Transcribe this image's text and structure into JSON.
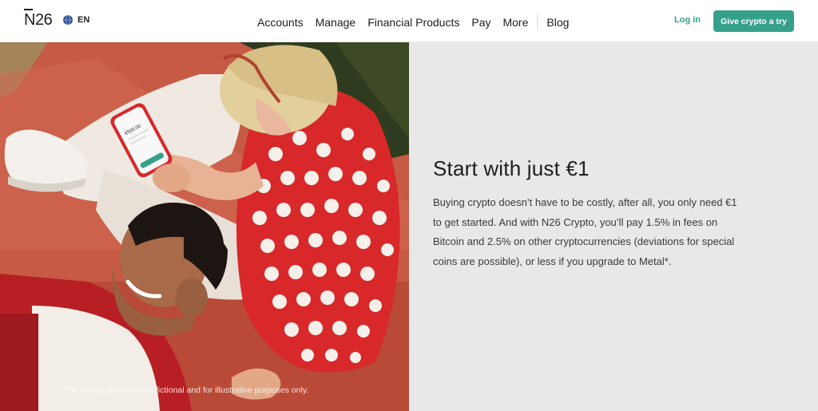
{
  "header": {
    "logo": "N26",
    "language": "EN",
    "nav": [
      "Accounts",
      "Manage",
      "Financial Products",
      "Pay",
      "More"
    ],
    "blog": "Blog",
    "login": "Log in",
    "cta": "Give crypto a try"
  },
  "hero": {
    "disclaimer": "The values depicted are fictional and for illustrative purposes only.",
    "phone_amount": "€500.00"
  },
  "content": {
    "headline": "Start with just €1",
    "body": "Buying crypto doesn’t have to be costly, after all, you only need €1 to get started. And with N26 Crypto, you’ll pay 1.5% in fees on Bitcoin and 2.5% on other cryptocurrencies (deviations for special coins are possible), or less if you upgrade to Metal*."
  },
  "colors": {
    "accent": "#36a18b",
    "panel_bg": "#e8e8e8",
    "text": "#1e1e1e"
  },
  "icons": {
    "language": "globe-icon"
  }
}
